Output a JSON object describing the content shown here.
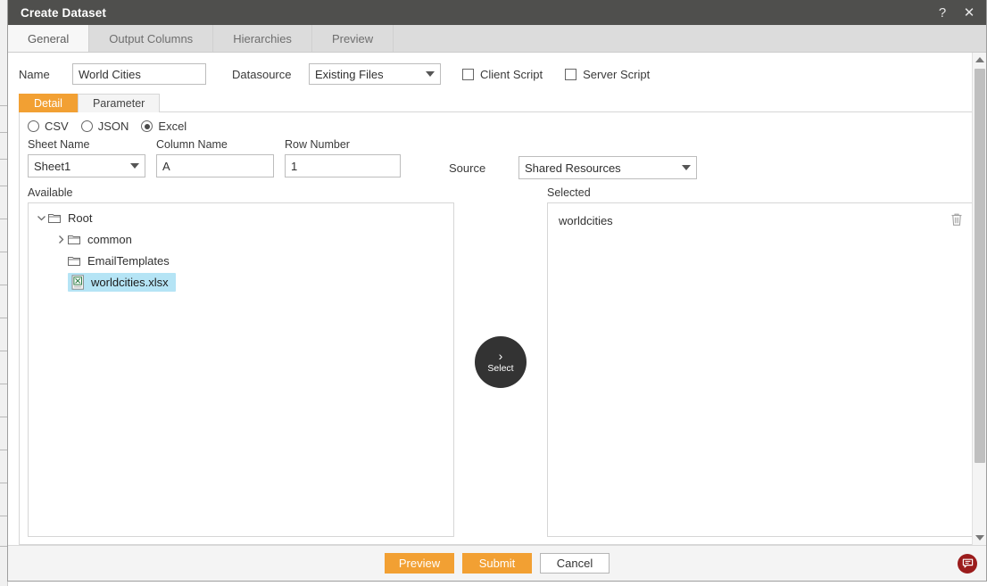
{
  "window": {
    "title": "Create Dataset",
    "help_icon": "question-mark-icon",
    "close_icon": "close-icon"
  },
  "tabs": [
    {
      "label": "General",
      "active": true
    },
    {
      "label": "Output Columns",
      "active": false
    },
    {
      "label": "Hierarchies",
      "active": false
    },
    {
      "label": "Preview",
      "active": false
    }
  ],
  "general": {
    "name_label": "Name",
    "name_value": "World Cities",
    "datasource_label": "Datasource",
    "datasource_value": "Existing Files",
    "client_script_label": "Client Script",
    "client_script_checked": false,
    "server_script_label": "Server Script",
    "server_script_checked": false
  },
  "subtabs": [
    {
      "label": "Detail",
      "active": true
    },
    {
      "label": "Parameter",
      "active": false
    }
  ],
  "detail": {
    "formats": [
      {
        "label": "CSV",
        "selected": false
      },
      {
        "label": "JSON",
        "selected": false
      },
      {
        "label": "Excel",
        "selected": true
      }
    ],
    "sheet_name_label": "Sheet Name",
    "sheet_name_value": "Sheet1",
    "column_name_label": "Column Name",
    "column_name_value": "A",
    "row_number_label": "Row Number",
    "row_number_value": "1",
    "source_label": "Source",
    "source_value": "Shared Resources",
    "available_label": "Available",
    "selected_label": "Selected",
    "tree": [
      {
        "label": "Root",
        "type": "folder",
        "depth": 0,
        "expanded": true,
        "has_twisty": true,
        "highlighted": false
      },
      {
        "label": "common",
        "type": "folder",
        "depth": 1,
        "expanded": false,
        "has_twisty": true,
        "highlighted": false
      },
      {
        "label": "EmailTemplates",
        "type": "folder",
        "depth": 1,
        "expanded": false,
        "has_twisty": false,
        "highlighted": false
      },
      {
        "label": "worldcities.xlsx",
        "type": "excel-file",
        "depth": 2,
        "expanded": false,
        "has_twisty": false,
        "highlighted": true
      }
    ],
    "selected_items": [
      {
        "label": "worldcities",
        "delete_icon": "trash-icon"
      }
    ],
    "select_button": {
      "label": "Select",
      "icon": "chevron-right-icon"
    }
  },
  "footer": {
    "buttons": [
      {
        "label": "Preview",
        "style": "primary"
      },
      {
        "label": "Submit",
        "style": "primary"
      },
      {
        "label": "Cancel",
        "style": "secondary"
      }
    ],
    "feedback_icon": "chat-feedback-icon"
  },
  "colors": {
    "accent": "#f2a033",
    "titlebar": "#4f4f4d",
    "tree_highlight": "#b5e4f5",
    "select_button": "#333333",
    "feedback": "#9b1c1c"
  },
  "scrollbar": {
    "up_icon": "triangle-up-icon",
    "down_icon": "triangle-down-icon"
  }
}
